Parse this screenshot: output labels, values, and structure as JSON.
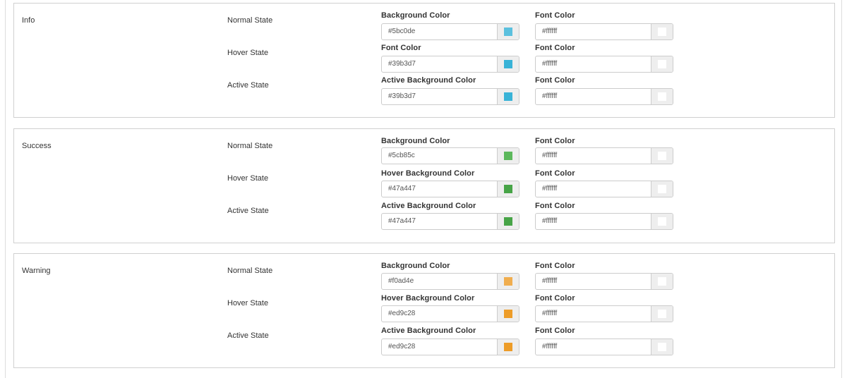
{
  "colors": {
    "panel_border": "#d0d0d0",
    "input_border": "#cccccc",
    "addon_bg": "#eeeeee"
  },
  "panels": [
    {
      "title": "Info",
      "rows": [
        {
          "state": "Normal State",
          "bg_label": "Background Color",
          "bg_value": "#5bc0de",
          "bg_swatch": "#5bc0de",
          "font_label": "Font Color",
          "font_value": "#ffffff",
          "font_swatch": "#ffffff"
        },
        {
          "state": "Hover State",
          "bg_label": "Font Color",
          "bg_value": "#39b3d7",
          "bg_swatch": "#39b3d7",
          "font_label": "Font Color",
          "font_value": "#ffffff",
          "font_swatch": "#ffffff"
        },
        {
          "state": "Active State",
          "bg_label": "Active Background Color",
          "bg_value": "#39b3d7",
          "bg_swatch": "#39b3d7",
          "font_label": "Font Color",
          "font_value": "#ffffff",
          "font_swatch": "#ffffff"
        }
      ]
    },
    {
      "title": "Success",
      "rows": [
        {
          "state": "Normal State",
          "bg_label": "Background Color",
          "bg_value": "#5cb85c",
          "bg_swatch": "#5cb85c",
          "font_label": "Font Color",
          "font_value": "#ffffff",
          "font_swatch": "#ffffff"
        },
        {
          "state": "Hover State",
          "bg_label": "Hover Background Color",
          "bg_value": "#47a447",
          "bg_swatch": "#47a447",
          "font_label": "Font Color",
          "font_value": "#ffffff",
          "font_swatch": "#ffffff"
        },
        {
          "state": "Active State",
          "bg_label": "Active Background Color",
          "bg_value": "#47a447",
          "bg_swatch": "#47a447",
          "font_label": "Font Color",
          "font_value": "#ffffff",
          "font_swatch": "#ffffff"
        }
      ]
    },
    {
      "title": "Warning",
      "rows": [
        {
          "state": "Normal State",
          "bg_label": "Background Color",
          "bg_value": "#f0ad4e",
          "bg_swatch": "#f0ad4e",
          "font_label": "Font Color",
          "font_value": "#ffffff",
          "font_swatch": "#ffffff"
        },
        {
          "state": "Hover State",
          "bg_label": "Hover Background Color",
          "bg_value": "#ed9c28",
          "bg_swatch": "#ed9c28",
          "font_label": "Font Color",
          "font_value": "#ffffff",
          "font_swatch": "#ffffff"
        },
        {
          "state": "Active State",
          "bg_label": "Active Background Color",
          "bg_value": "#ed9c28",
          "bg_swatch": "#ed9c28",
          "font_label": "Font Color",
          "font_value": "#ffffff",
          "font_swatch": "#ffffff"
        }
      ]
    }
  ]
}
